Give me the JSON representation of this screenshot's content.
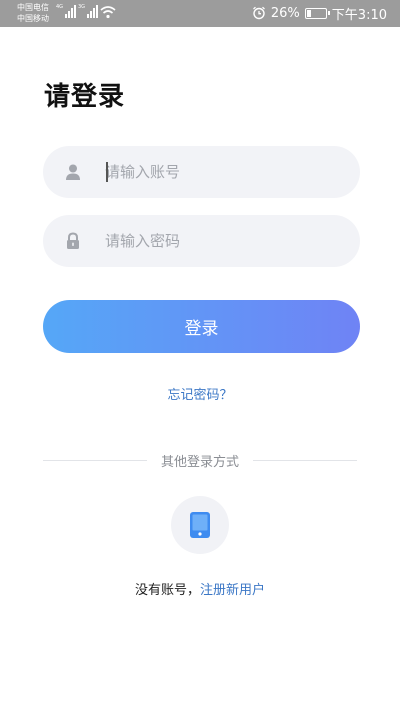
{
  "status_bar": {
    "carrier_1": "中国电信",
    "carrier_2": "中国移动",
    "sig1_label": "4G",
    "sig2_label": "3G",
    "battery": "26%",
    "battery_level": 0.26,
    "time": "下午3:10"
  },
  "page": {
    "title": "请登录"
  },
  "form": {
    "account_placeholder": "请输入账号",
    "password_placeholder": "请输入密码",
    "login_label": "登录",
    "forgot_label": "忘记密码？"
  },
  "other_login": {
    "label": "其他登录方式",
    "icon": "phone-icon"
  },
  "register": {
    "prompt": "没有账号，",
    "link": "注册新用户"
  },
  "colors": {
    "accent": "#3b77c6",
    "button_gradient_start": "#55a7f7",
    "button_gradient_end": "#6f83f5",
    "field_bg": "#f2f3f7",
    "phone_icon": "#3f8cf0"
  }
}
